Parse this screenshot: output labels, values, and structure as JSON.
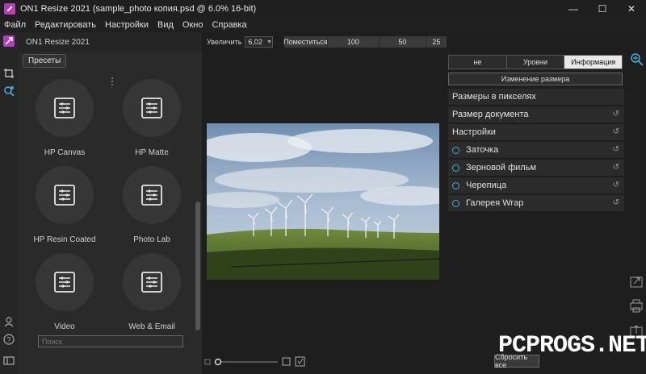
{
  "window": {
    "title": "ON1 Resize 2021 (sample_photo копия.psd @ 6.0% 16-bit)",
    "controls": {
      "minimize": "—",
      "maximize": "☐",
      "close": "✕"
    }
  },
  "menu": [
    "Файл",
    "Редактировать",
    "Настройки",
    "Вид",
    "Окно",
    "Справка"
  ],
  "left_panel": {
    "brand": "ON1 Resize 2021",
    "presets_button": "Пресеты",
    "presets": [
      {
        "label": "HP Canvas"
      },
      {
        "label": "HP Matte"
      },
      {
        "label": "HP Resin Coated"
      },
      {
        "label": "Photo Lab"
      },
      {
        "label": "Video"
      },
      {
        "label": "Web & Email"
      }
    ],
    "search_placeholder": "Поиск"
  },
  "zoom": {
    "label": "Увеличить",
    "value": "6,02",
    "fit_label": "Поместиться",
    "presets": [
      "100",
      "50",
      "25"
    ]
  },
  "right_panel": {
    "tabs": [
      {
        "label": "не",
        "active": false
      },
      {
        "label": "Уровни",
        "active": false
      },
      {
        "label": "Информация",
        "active": true
      }
    ],
    "resize_button": "Изменение размера",
    "sections": [
      {
        "label": "Размеры в пикселях",
        "dot": false,
        "reset": false
      },
      {
        "label": "Размер документа",
        "dot": false,
        "reset": true
      },
      {
        "label": "Настройки",
        "dot": false,
        "reset": true
      },
      {
        "label": "Заточка",
        "dot": true,
        "reset": true
      },
      {
        "label": "Зерновой фильм",
        "dot": true,
        "reset": true
      },
      {
        "label": "Черепица",
        "dot": true,
        "reset": true
      },
      {
        "label": "Галерея Wrap",
        "dot": true,
        "reset": true
      }
    ]
  },
  "bottom": {
    "reset_button": "Сбросить все"
  },
  "watermark": "PCPROGS.NET",
  "colors": {
    "accent": "#4aa8d8",
    "brand": "#b040c0",
    "panel": "#2a2a2a",
    "background": "#1e1e1e"
  }
}
